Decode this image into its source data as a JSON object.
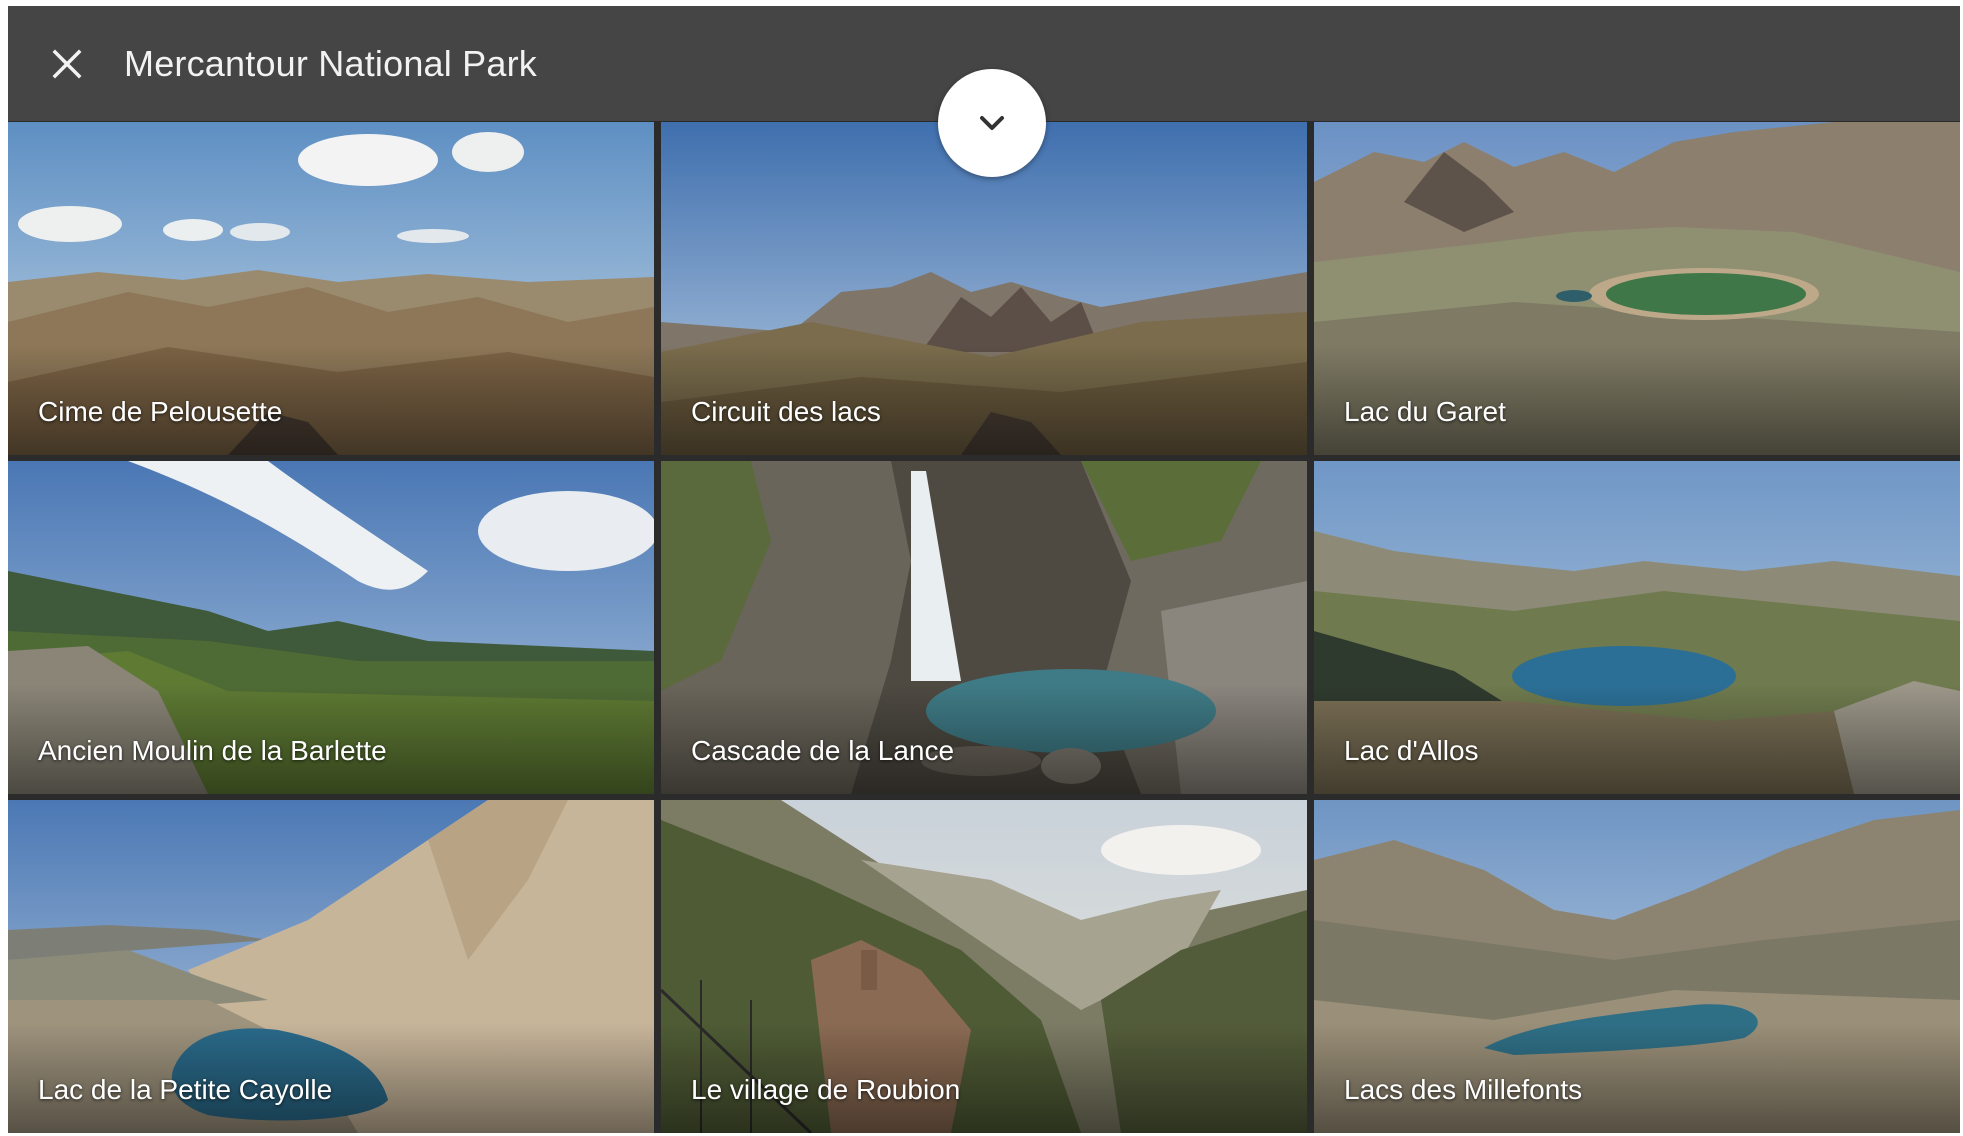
{
  "header": {
    "title": "Mercantour National Park",
    "close_icon": "close-icon"
  },
  "collapse_button": {
    "icon": "chevron-down-icon"
  },
  "tiles": [
    {
      "label": "Cime de Pelousette"
    },
    {
      "label": "Circuit des lacs"
    },
    {
      "label": "Lac du Garet"
    },
    {
      "label": "Ancien Moulin de la Barlette"
    },
    {
      "label": "Cascade de la Lance"
    },
    {
      "label": "Lac d'Allos"
    },
    {
      "label": "Lac de la Petite Cayolle"
    },
    {
      "label": "Le village de Roubion"
    },
    {
      "label": "Lacs des Millefonts"
    }
  ]
}
